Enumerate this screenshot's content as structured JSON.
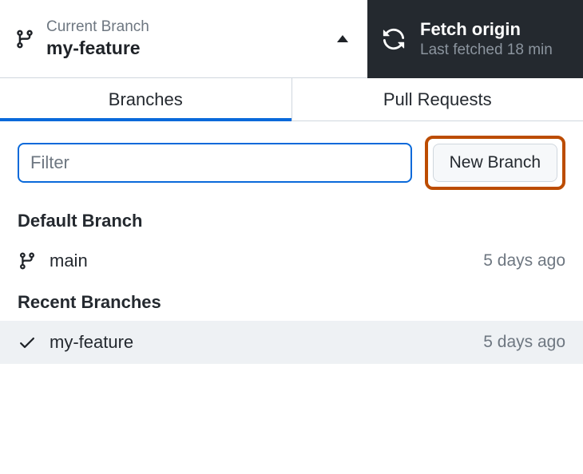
{
  "header": {
    "currentBranchLabel": "Current Branch",
    "currentBranchName": "my-feature",
    "fetchTitle": "Fetch origin",
    "fetchSub": "Last fetched 18 min"
  },
  "tabs": {
    "branches": "Branches",
    "pullRequests": "Pull Requests"
  },
  "filter": {
    "placeholder": "Filter",
    "value": ""
  },
  "newBranchLabel": "New Branch",
  "sections": {
    "defaultBranch": "Default Branch",
    "recentBranches": "Recent Branches"
  },
  "defaultBranch": {
    "name": "main",
    "time": "5 days ago"
  },
  "recentBranches": [
    {
      "name": "my-feature",
      "time": "5 days ago",
      "selected": true
    }
  ]
}
